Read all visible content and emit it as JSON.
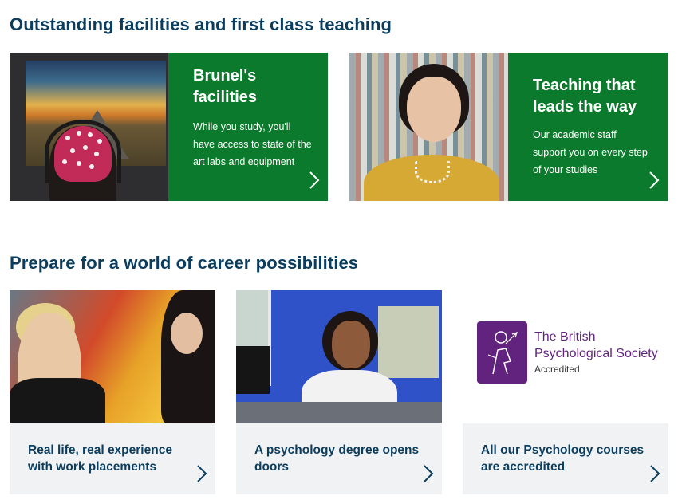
{
  "sections": {
    "facilities_title": "Outstanding facilities and first class teaching",
    "careers_title": "Prepare for a world of career possibilities"
  },
  "features": [
    {
      "title": "Brunel's facilities",
      "text": "While you study, you'll have access to state of the art labs and equipment",
      "icon": "chevron-right-icon"
    },
    {
      "title": "Teaching that leads the way",
      "text": "Our academic staff support you on every step of your studies",
      "icon": "chevron-right-icon"
    }
  ],
  "careers": [
    {
      "label": "Real life, real experience with work placements",
      "icon": "chevron-right-icon"
    },
    {
      "label": "A psychology degree opens doors",
      "icon": "chevron-right-icon"
    },
    {
      "label": "All our Psychology courses are accredited",
      "icon": "chevron-right-icon"
    }
  ],
  "bps_logo": {
    "name_line1": "The British",
    "name_line2": "Psychological Society",
    "subtitle": "Accredited"
  },
  "colors": {
    "heading": "#0b3d5e",
    "feature_panel": "#0b7a2c",
    "caption_bg": "#f0f2f3",
    "bps_purple": "#62237f"
  }
}
